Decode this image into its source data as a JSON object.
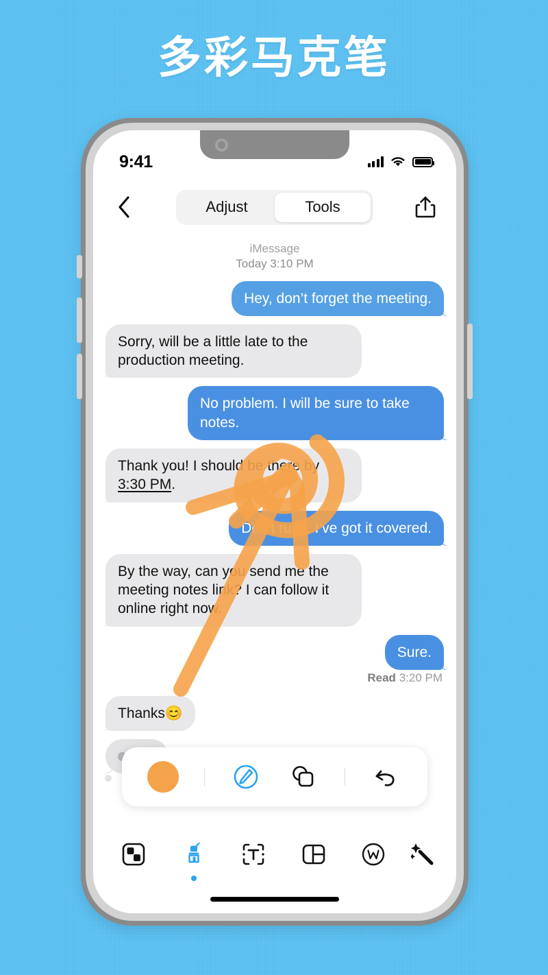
{
  "headline": "多彩马克笔",
  "colors": {
    "background": "#5cc4f7",
    "marker_orange": "#f5a34a",
    "bubble_out_blue": "#4a90e2",
    "bubble_out_blue_light": "#55a0e5",
    "bubble_in_gray": "#e8e8ea",
    "accent_blue": "#2aa3ef"
  },
  "status_bar": {
    "time": "9:41",
    "signal_icon": "cellular-bars-icon",
    "wifi_icon": "wifi-icon",
    "battery_icon": "battery-icon"
  },
  "nav_bar": {
    "back_icon": "chevron-left-icon",
    "share_icon": "share-up-arrow-icon",
    "segments": [
      {
        "label": "Adjust",
        "active": false
      },
      {
        "label": "Tools",
        "active": true
      }
    ]
  },
  "conversation": {
    "service_label": "iMessage",
    "timestamp": "Today 3:10 PM",
    "messages": [
      {
        "side": "out",
        "tone": "light",
        "text": "Hey, don’t forget the meeting."
      },
      {
        "side": "in",
        "text": "Sorry, will be a little late to the production meeting."
      },
      {
        "side": "out",
        "tone": "normal",
        "text": "No problem. I will be sure to take notes."
      },
      {
        "side": "in",
        "text_pre": "Thank you! I should be there by ",
        "link": "3:30 PM",
        "text_post": "."
      },
      {
        "side": "out",
        "tone": "normal",
        "text": "Don’t rush. I’ve got it covered."
      },
      {
        "side": "in",
        "text": "By the way, can you send me the meeting notes link? I can follow it online right now."
      },
      {
        "side": "out",
        "tone": "normal",
        "text": "Sure."
      }
    ],
    "read_receipt_label": "Read",
    "read_receipt_time": "3:20 PM",
    "last_in_message": "Thanks😊",
    "typing_indicator": "typing-indicator"
  },
  "palette": {
    "color_swatch": "#f5a34a",
    "items": [
      {
        "name": "color-swatch",
        "icon": "filled-circle-icon"
      },
      {
        "name": "divider-1",
        "icon": "divider"
      },
      {
        "name": "opacity-tool",
        "icon": "marker-opacity-circle-icon"
      },
      {
        "name": "shapes-tool",
        "icon": "shapes-overlap-icon"
      },
      {
        "name": "divider-2",
        "icon": "divider"
      },
      {
        "name": "undo-tool",
        "icon": "undo-arrow-icon"
      }
    ]
  },
  "tabbar": {
    "items": [
      {
        "name": "mosaic",
        "icon": "mosaic-squares-icon",
        "active": false
      },
      {
        "name": "marker",
        "icon": "highlighter-marker-icon",
        "active": true
      },
      {
        "name": "text",
        "icon": "text-box-t-icon",
        "active": false
      },
      {
        "name": "layout",
        "icon": "layout-panels-icon",
        "active": false
      },
      {
        "name": "watermark",
        "icon": "watermark-w-circle-icon",
        "active": false
      },
      {
        "name": "magic",
        "icon": "magic-wand-sparkle-icon",
        "active": false
      }
    ]
  },
  "annotations": {
    "stroke_color": "#f5a34a",
    "stroke_opacity": 0.88,
    "strokes": [
      {
        "name": "spiral-swirl",
        "kind": "spiral"
      },
      {
        "name": "arrow-head-left-arm",
        "kind": "line"
      },
      {
        "name": "arrow-head-peak",
        "kind": "line"
      },
      {
        "name": "arrow-tail-long-diagonal",
        "kind": "line"
      }
    ]
  },
  "home_indicator": "home-indicator"
}
